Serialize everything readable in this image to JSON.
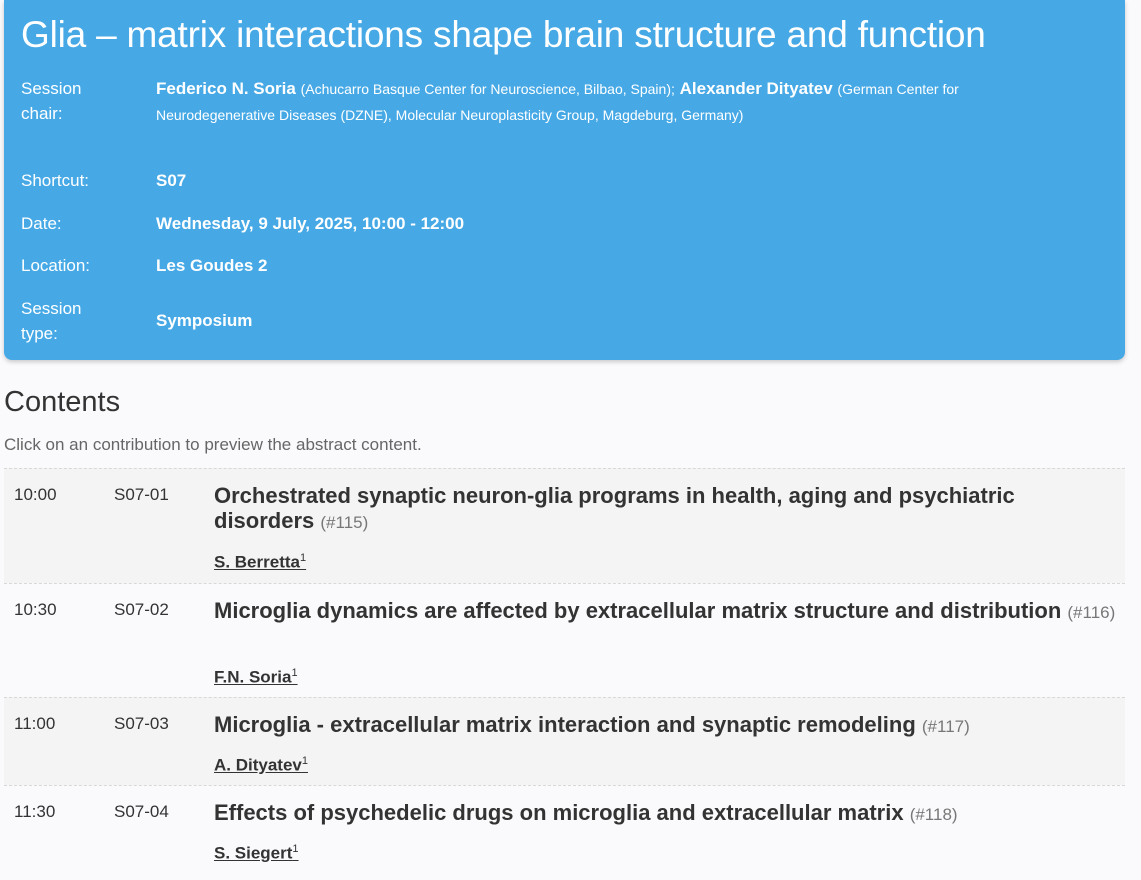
{
  "session": {
    "title": "Glia – matrix interactions shape brain structure and function",
    "chair_label_1": "Session",
    "chair_label_2": "chair:",
    "chair1_name": "Federico N. Soria",
    "chair1_aff": "(Achucarro Basque Center for Neuroscience, Bilbao, Spain);",
    "chair2_name": "Alexander Dityatev",
    "chair2_aff": "(German Center for Neurodegenerative Diseases (DZNE), Molecular Neuroplasticity Group, Magdeburg, Germany)",
    "shortcut_label": "Shortcut:",
    "shortcut_value": "S07",
    "date_label": "Date:",
    "date_value": "Wednesday, 9 July, 2025, 10:00 - 12:00",
    "location_label": "Location:",
    "location_value": "Les Goudes 2",
    "type_label_1": "Session",
    "type_label_2": "type:",
    "type_value": "Symposium"
  },
  "contents": {
    "heading": "Contents",
    "hint": "Click on an contribution to preview the abstract content.",
    "items": [
      {
        "time": "10:00",
        "code": "S07-01",
        "title": "Orchestrated synaptic neuron-glia programs in health, aging and psychiatric disorders",
        "abstract": "(#115)",
        "author": "S. Berretta",
        "sup": "1"
      },
      {
        "time": "10:30",
        "code": "S07-02",
        "title": "Microglia dynamics are affected by extracellular matrix structure and distribution",
        "abstract": "(#116)",
        "author": "F.N. Soria",
        "sup": "1"
      },
      {
        "time": "11:00",
        "code": "S07-03",
        "title": "Microglia - extracellular matrix interaction and synaptic remodeling",
        "abstract": "(#117)",
        "author": "A. Dityatev",
        "sup": "1"
      },
      {
        "time": "11:30",
        "code": "S07-04",
        "title": "Effects of psychedelic drugs on microglia and extracellular matrix",
        "abstract": "(#118)",
        "author": "S. Siegert",
        "sup": "1"
      }
    ]
  }
}
